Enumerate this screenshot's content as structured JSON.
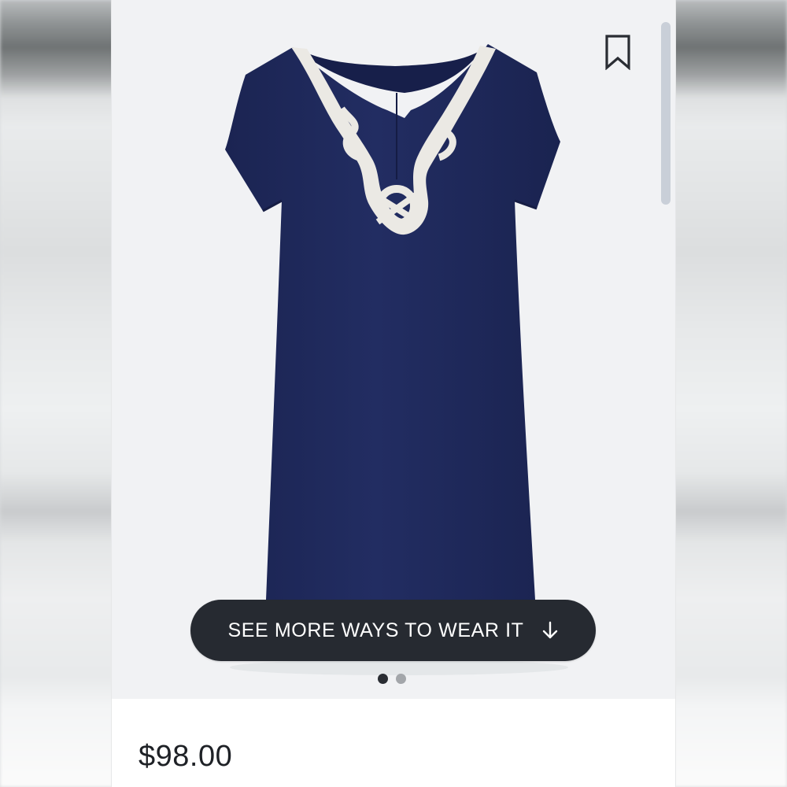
{
  "product": {
    "image_alt": "",
    "cta_label": "SEE MORE WAYS TO WEAR IT",
    "cta_icon": "arrow-down-icon",
    "bookmark_icon": "bookmark-icon",
    "carousel": {
      "total": 2,
      "active": 1
    },
    "price": "$98.00"
  },
  "colors": {
    "dress": "#1f2a5c",
    "trim": "#ebe9e4",
    "hero_background": "#f1f2f4",
    "button": "#262a31"
  }
}
